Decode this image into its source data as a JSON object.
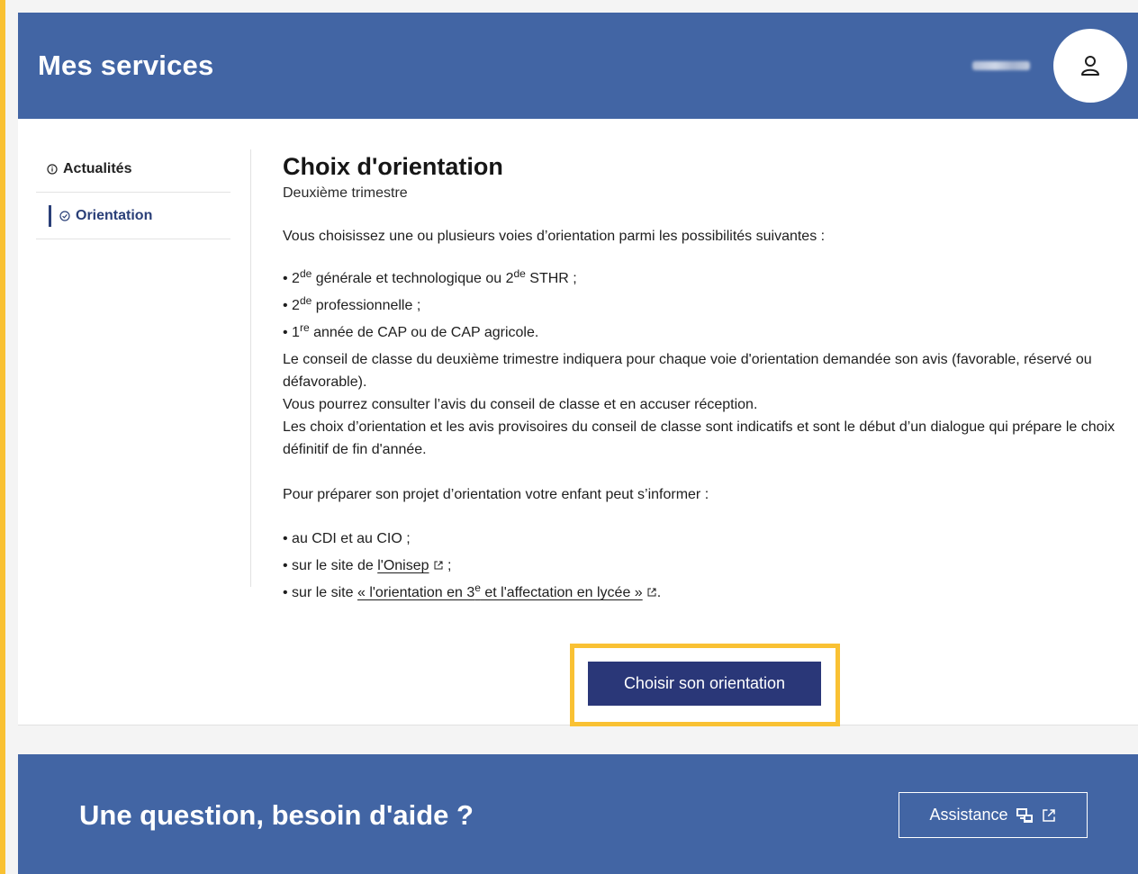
{
  "header": {
    "title": "Mes services"
  },
  "sidebar": {
    "items": [
      {
        "label": "Actualités"
      },
      {
        "label": "Orientation"
      }
    ]
  },
  "content": {
    "title": "Choix d'orientation",
    "subtitle": "Deuxième trimestre",
    "intro": "Vous choisissez une ou plusieurs voies d’orientation parmi les possibilités suivantes :",
    "options": {
      "o1_a": "2",
      "o1_sup1": "de",
      "o1_b": " générale et technologique ou 2",
      "o1_sup2": "de",
      "o1_c": " STHR ;",
      "o2_a": "2",
      "o2_sup": "de",
      "o2_b": " professionnelle ;",
      "o3_a": "1",
      "o3_sup": "re",
      "o3_b": " année de CAP ou de CAP agricole."
    },
    "conseil_line1": "Le conseil de classe du deuxième trimestre indiquera pour chaque voie d'orientation demandée son avis (favorable, réservé ou défavorable).",
    "conseil_line2": "Vous pourrez consulter l’avis du conseil de classe et en accuser réception.",
    "conseil_line3": "Les choix d’orientation et les avis provisoires du conseil de classe sont indicatifs et sont le début d’un dialogue qui prépare le choix définitif de fin d'année.",
    "prepare": "Pour préparer son projet d’orientation votre enfant peut s’informer :",
    "info": {
      "i1": "au CDI et au CIO ;",
      "i2_prefix": "sur le site de ",
      "i2_link": "l'Onisep",
      "i2_suffix": " ;",
      "i3_prefix": "sur le site ",
      "i3_link_a": "« l'orientation en 3",
      "i3_link_sup": "e",
      "i3_link_b": " et l'affectation en lycée »",
      "i3_suffix": "."
    },
    "cta_label": "Choisir son orientation"
  },
  "footer": {
    "title": "Une question, besoin d'aide ?",
    "assist_label": "Assistance"
  },
  "icons": {
    "user": "user-icon",
    "info": "info-circle-icon",
    "check": "check-circle-icon",
    "external": "external-link-icon",
    "assistance": "assistance-icon"
  },
  "colors": {
    "brand_blue": "#4265a4",
    "cta_blue": "#2a3778",
    "highlight_yellow": "#f9c133"
  }
}
